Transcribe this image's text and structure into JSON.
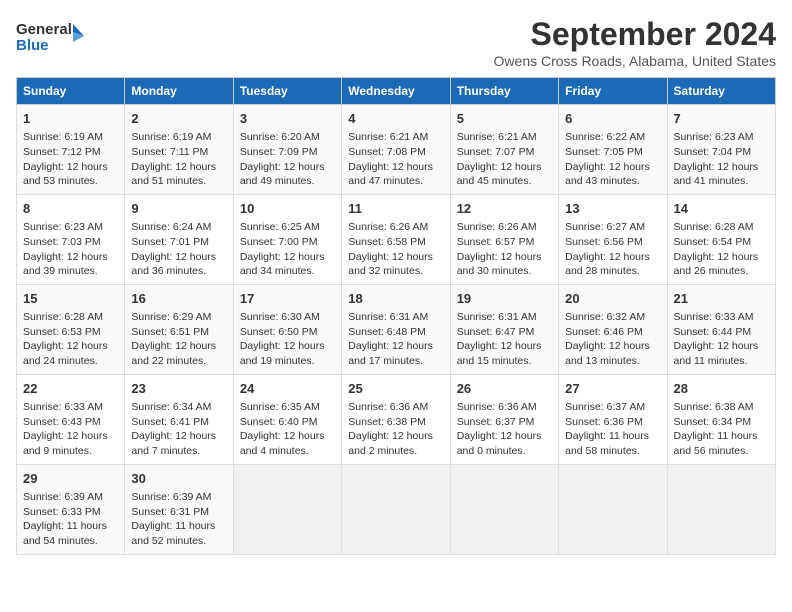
{
  "logo": {
    "line1": "General",
    "line2": "Blue"
  },
  "title": "September 2024",
  "subtitle": "Owens Cross Roads, Alabama, United States",
  "days_of_week": [
    "Sunday",
    "Monday",
    "Tuesday",
    "Wednesday",
    "Thursday",
    "Friday",
    "Saturday"
  ],
  "weeks": [
    [
      {
        "day": "1",
        "lines": [
          "Sunrise: 6:19 AM",
          "Sunset: 7:12 PM",
          "Daylight: 12 hours",
          "and 53 minutes."
        ]
      },
      {
        "day": "2",
        "lines": [
          "Sunrise: 6:19 AM",
          "Sunset: 7:11 PM",
          "Daylight: 12 hours",
          "and 51 minutes."
        ]
      },
      {
        "day": "3",
        "lines": [
          "Sunrise: 6:20 AM",
          "Sunset: 7:09 PM",
          "Daylight: 12 hours",
          "and 49 minutes."
        ]
      },
      {
        "day": "4",
        "lines": [
          "Sunrise: 6:21 AM",
          "Sunset: 7:08 PM",
          "Daylight: 12 hours",
          "and 47 minutes."
        ]
      },
      {
        "day": "5",
        "lines": [
          "Sunrise: 6:21 AM",
          "Sunset: 7:07 PM",
          "Daylight: 12 hours",
          "and 45 minutes."
        ]
      },
      {
        "day": "6",
        "lines": [
          "Sunrise: 6:22 AM",
          "Sunset: 7:05 PM",
          "Daylight: 12 hours",
          "and 43 minutes."
        ]
      },
      {
        "day": "7",
        "lines": [
          "Sunrise: 6:23 AM",
          "Sunset: 7:04 PM",
          "Daylight: 12 hours",
          "and 41 minutes."
        ]
      }
    ],
    [
      {
        "day": "8",
        "lines": [
          "Sunrise: 6:23 AM",
          "Sunset: 7:03 PM",
          "Daylight: 12 hours",
          "and 39 minutes."
        ]
      },
      {
        "day": "9",
        "lines": [
          "Sunrise: 6:24 AM",
          "Sunset: 7:01 PM",
          "Daylight: 12 hours",
          "and 36 minutes."
        ]
      },
      {
        "day": "10",
        "lines": [
          "Sunrise: 6:25 AM",
          "Sunset: 7:00 PM",
          "Daylight: 12 hours",
          "and 34 minutes."
        ]
      },
      {
        "day": "11",
        "lines": [
          "Sunrise: 6:26 AM",
          "Sunset: 6:58 PM",
          "Daylight: 12 hours",
          "and 32 minutes."
        ]
      },
      {
        "day": "12",
        "lines": [
          "Sunrise: 6:26 AM",
          "Sunset: 6:57 PM",
          "Daylight: 12 hours",
          "and 30 minutes."
        ]
      },
      {
        "day": "13",
        "lines": [
          "Sunrise: 6:27 AM",
          "Sunset: 6:56 PM",
          "Daylight: 12 hours",
          "and 28 minutes."
        ]
      },
      {
        "day": "14",
        "lines": [
          "Sunrise: 6:28 AM",
          "Sunset: 6:54 PM",
          "Daylight: 12 hours",
          "and 26 minutes."
        ]
      }
    ],
    [
      {
        "day": "15",
        "lines": [
          "Sunrise: 6:28 AM",
          "Sunset: 6:53 PM",
          "Daylight: 12 hours",
          "and 24 minutes."
        ]
      },
      {
        "day": "16",
        "lines": [
          "Sunrise: 6:29 AM",
          "Sunset: 6:51 PM",
          "Daylight: 12 hours",
          "and 22 minutes."
        ]
      },
      {
        "day": "17",
        "lines": [
          "Sunrise: 6:30 AM",
          "Sunset: 6:50 PM",
          "Daylight: 12 hours",
          "and 19 minutes."
        ]
      },
      {
        "day": "18",
        "lines": [
          "Sunrise: 6:31 AM",
          "Sunset: 6:48 PM",
          "Daylight: 12 hours",
          "and 17 minutes."
        ]
      },
      {
        "day": "19",
        "lines": [
          "Sunrise: 6:31 AM",
          "Sunset: 6:47 PM",
          "Daylight: 12 hours",
          "and 15 minutes."
        ]
      },
      {
        "day": "20",
        "lines": [
          "Sunrise: 6:32 AM",
          "Sunset: 6:46 PM",
          "Daylight: 12 hours",
          "and 13 minutes."
        ]
      },
      {
        "day": "21",
        "lines": [
          "Sunrise: 6:33 AM",
          "Sunset: 6:44 PM",
          "Daylight: 12 hours",
          "and 11 minutes."
        ]
      }
    ],
    [
      {
        "day": "22",
        "lines": [
          "Sunrise: 6:33 AM",
          "Sunset: 6:43 PM",
          "Daylight: 12 hours",
          "and 9 minutes."
        ]
      },
      {
        "day": "23",
        "lines": [
          "Sunrise: 6:34 AM",
          "Sunset: 6:41 PM",
          "Daylight: 12 hours",
          "and 7 minutes."
        ]
      },
      {
        "day": "24",
        "lines": [
          "Sunrise: 6:35 AM",
          "Sunset: 6:40 PM",
          "Daylight: 12 hours",
          "and 4 minutes."
        ]
      },
      {
        "day": "25",
        "lines": [
          "Sunrise: 6:36 AM",
          "Sunset: 6:38 PM",
          "Daylight: 12 hours",
          "and 2 minutes."
        ]
      },
      {
        "day": "26",
        "lines": [
          "Sunrise: 6:36 AM",
          "Sunset: 6:37 PM",
          "Daylight: 12 hours",
          "and 0 minutes."
        ]
      },
      {
        "day": "27",
        "lines": [
          "Sunrise: 6:37 AM",
          "Sunset: 6:36 PM",
          "Daylight: 11 hours",
          "and 58 minutes."
        ]
      },
      {
        "day": "28",
        "lines": [
          "Sunrise: 6:38 AM",
          "Sunset: 6:34 PM",
          "Daylight: 11 hours",
          "and 56 minutes."
        ]
      }
    ],
    [
      {
        "day": "29",
        "lines": [
          "Sunrise: 6:39 AM",
          "Sunset: 6:33 PM",
          "Daylight: 11 hours",
          "and 54 minutes."
        ]
      },
      {
        "day": "30",
        "lines": [
          "Sunrise: 6:39 AM",
          "Sunset: 6:31 PM",
          "Daylight: 11 hours",
          "and 52 minutes."
        ]
      },
      {
        "day": "",
        "lines": []
      },
      {
        "day": "",
        "lines": []
      },
      {
        "day": "",
        "lines": []
      },
      {
        "day": "",
        "lines": []
      },
      {
        "day": "",
        "lines": []
      }
    ]
  ]
}
